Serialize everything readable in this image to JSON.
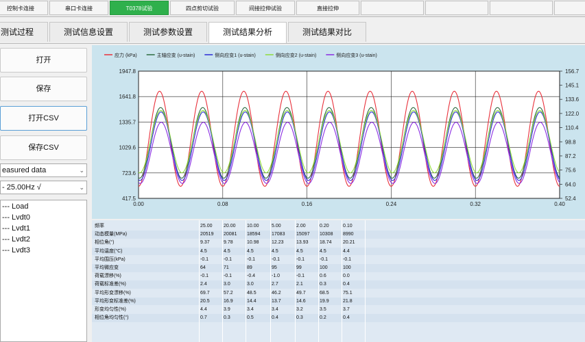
{
  "top_tabs": [
    {
      "label": "控制卡连接",
      "active": false
    },
    {
      "label": "串口卡连接",
      "active": false
    },
    {
      "label": "T0378试验",
      "active": true
    },
    {
      "label": "四点剪切试验",
      "active": false
    },
    {
      "label": "间接拉伸试验",
      "active": false
    },
    {
      "label": "直接拉伸",
      "active": false
    }
  ],
  "sub_tabs": [
    {
      "label": "测试过程",
      "active": false
    },
    {
      "label": "测试信息设置",
      "active": false
    },
    {
      "label": "测试参数设置",
      "active": false
    },
    {
      "label": "测试结果分析",
      "active": true
    },
    {
      "label": "测试结果对比",
      "active": false
    }
  ],
  "left_panel": {
    "open_button": "打开",
    "save_button": "保存",
    "open_csv_button": "打开CSV",
    "save_csv_button": "保存CSV",
    "data_select": "easured data",
    "freq_select": "- 25.00Hz √",
    "tree_items": [
      "--- Load",
      "--- Lvdt0",
      "--- Lvdt1",
      "--- Lvdt2",
      "--- Lvdt3"
    ]
  },
  "chart_data": {
    "type": "line",
    "legend": [
      {
        "name": "应力 (kPa)",
        "color": "#e8303a"
      },
      {
        "name": "主轴应变 (u-stain)",
        "color": "#2b6b3f"
      },
      {
        "name": "侧向应变1 (u-stain)",
        "color": "#2b2bd6"
      },
      {
        "name": "侧向应变2 (u-stain)",
        "color": "#8fdc3a"
      },
      {
        "name": "侧向应变3 (u-stain)",
        "color": "#8a2be2"
      }
    ],
    "x_range": [
      0.0,
      0.4
    ],
    "x_ticks": [
      "0.00",
      "0.08",
      "0.16",
      "0.24",
      "0.32",
      "0.40"
    ],
    "y_left_range": [
      417.5,
      1947.8
    ],
    "y_left_ticks": [
      "1947.8",
      "1641.8",
      "1335.7",
      "1029.6",
      "723.6",
      "417.5"
    ],
    "y_right_range": [
      52.4,
      156.7
    ],
    "y_right_ticks": [
      "156.7",
      "145.1",
      "133.6",
      "122.0",
      "110.4",
      "98.8",
      "87.2",
      "75.6",
      "64.0",
      "52.4"
    ],
    "frequency_hz": 25,
    "series": [
      {
        "name": "应力 (kPa)",
        "mean": 1134,
        "amplitude": 572,
        "phase": 0.0
      },
      {
        "name": "主轴应变 (u-stain)",
        "mean": 1085,
        "amplitude": 425,
        "phase": -0.16
      },
      {
        "name": "侧向应变1 (u-stain)",
        "mean": 1045,
        "amplitude": 412,
        "phase": -0.22
      },
      {
        "name": "侧向应变2 (u-stain)",
        "mean": 1100,
        "amplitude": 375,
        "phase": -0.19
      },
      {
        "name": "侧向应变3 (u-stain)",
        "mean": 965,
        "amplitude": 368,
        "phase": -0.25
      }
    ]
  },
  "results_table": {
    "columns": [
      "频率",
      "25.00",
      "20.00",
      "10.00",
      "5.00",
      "2.00",
      "0.20",
      "0.10"
    ],
    "rows": [
      [
        "动态模量(MPa)",
        "20519",
        "20081",
        "18594",
        "17083",
        "15097",
        "10308",
        "8990"
      ],
      [
        "相位角(°)",
        "9.37",
        "9.78",
        "10.98",
        "12.23",
        "13.93",
        "18.74",
        "20.21"
      ],
      [
        "平均温度(°C)",
        "4.5",
        "4.5",
        "4.5",
        "4.5",
        "4.5",
        "4.5",
        "4.4"
      ],
      [
        "平均围压(kPa)",
        "-0.1",
        "-0.1",
        "-0.1",
        "-0.1",
        "-0.1",
        "-0.1",
        "-0.1"
      ],
      [
        "平均微应变",
        "64",
        "71",
        "89",
        "95",
        "99",
        "100",
        "100"
      ],
      [
        "荷载漂移(%)",
        "-0.1",
        "-0.1",
        "-0.4",
        "-1.0",
        "-0.1",
        "0.6",
        "0.0"
      ],
      [
        "荷载标准差(%)",
        "2.4",
        "3.0",
        "3.0",
        "2.7",
        "2.1",
        "0.3",
        "0.4"
      ],
      [
        "平均形变漂移(%)",
        "69.7",
        "57.2",
        "48.5",
        "46.2",
        "49.7",
        "68.5",
        "75.1"
      ],
      [
        "平均形变标准差(%)",
        "20.5",
        "16.9",
        "14.4",
        "13.7",
        "14.6",
        "19.9",
        "21.8"
      ],
      [
        "形变均匀性(%)",
        "4.4",
        "3.9",
        "3.4",
        "3.4",
        "3.2",
        "3.5",
        "3.7"
      ],
      [
        "相位角均匀性(°)",
        "0.7",
        "0.3",
        "0.5",
        "0.4",
        "0.3",
        "0.2",
        "0.4"
      ]
    ]
  }
}
